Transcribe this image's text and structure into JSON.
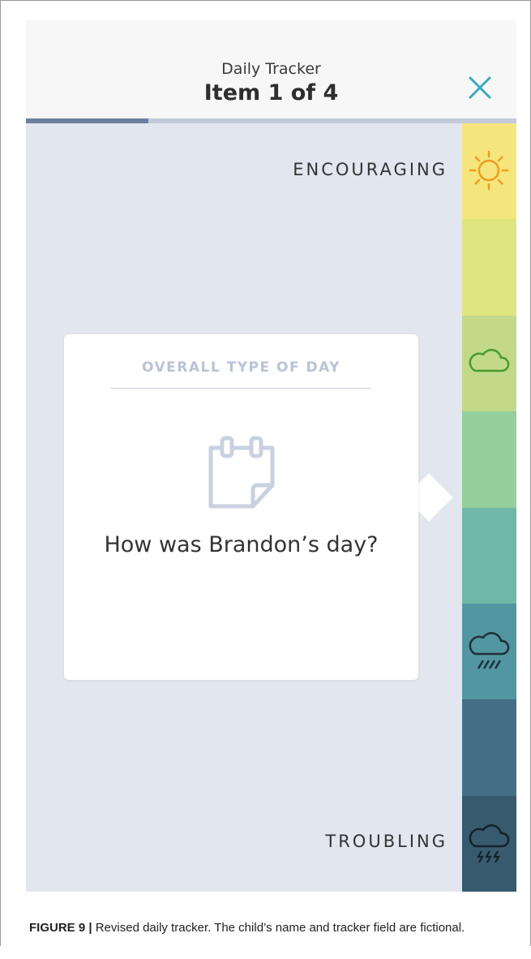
{
  "header": {
    "subtitle": "Daily Tracker",
    "title": "Item 1 of 4",
    "close_icon": "close-icon",
    "accent_color": "#3aa8c1"
  },
  "progress": {
    "current": 1,
    "total": 4,
    "fraction": 0.25,
    "track_color": "#c3cad9",
    "fill_color": "#6c7f9d"
  },
  "scale": {
    "top_label": "ENCOURAGING",
    "bottom_label": "TROUBLING",
    "levels": [
      {
        "color": "#f4e67c",
        "icon": "sun-icon"
      },
      {
        "color": "#dfe57e",
        "icon": ""
      },
      {
        "color": "#c2d98a",
        "icon": "cloud-icon"
      },
      {
        "color": "#95cf9d",
        "icon": ""
      },
      {
        "color": "#6fb7a7",
        "icon": ""
      },
      {
        "color": "#5296a1",
        "icon": "rain-cloud-icon"
      },
      {
        "color": "#436e86",
        "icon": ""
      },
      {
        "color": "#385a6e",
        "icon": "storm-cloud-icon"
      }
    ]
  },
  "card": {
    "heading": "OVERALL TYPE OF DAY",
    "icon": "notepad-icon",
    "question": "How was Brandon’s day?"
  },
  "caption": {
    "label": "FIGURE 9 |",
    "text": " Revised daily tracker. The child’s name and tracker field are fictional."
  }
}
